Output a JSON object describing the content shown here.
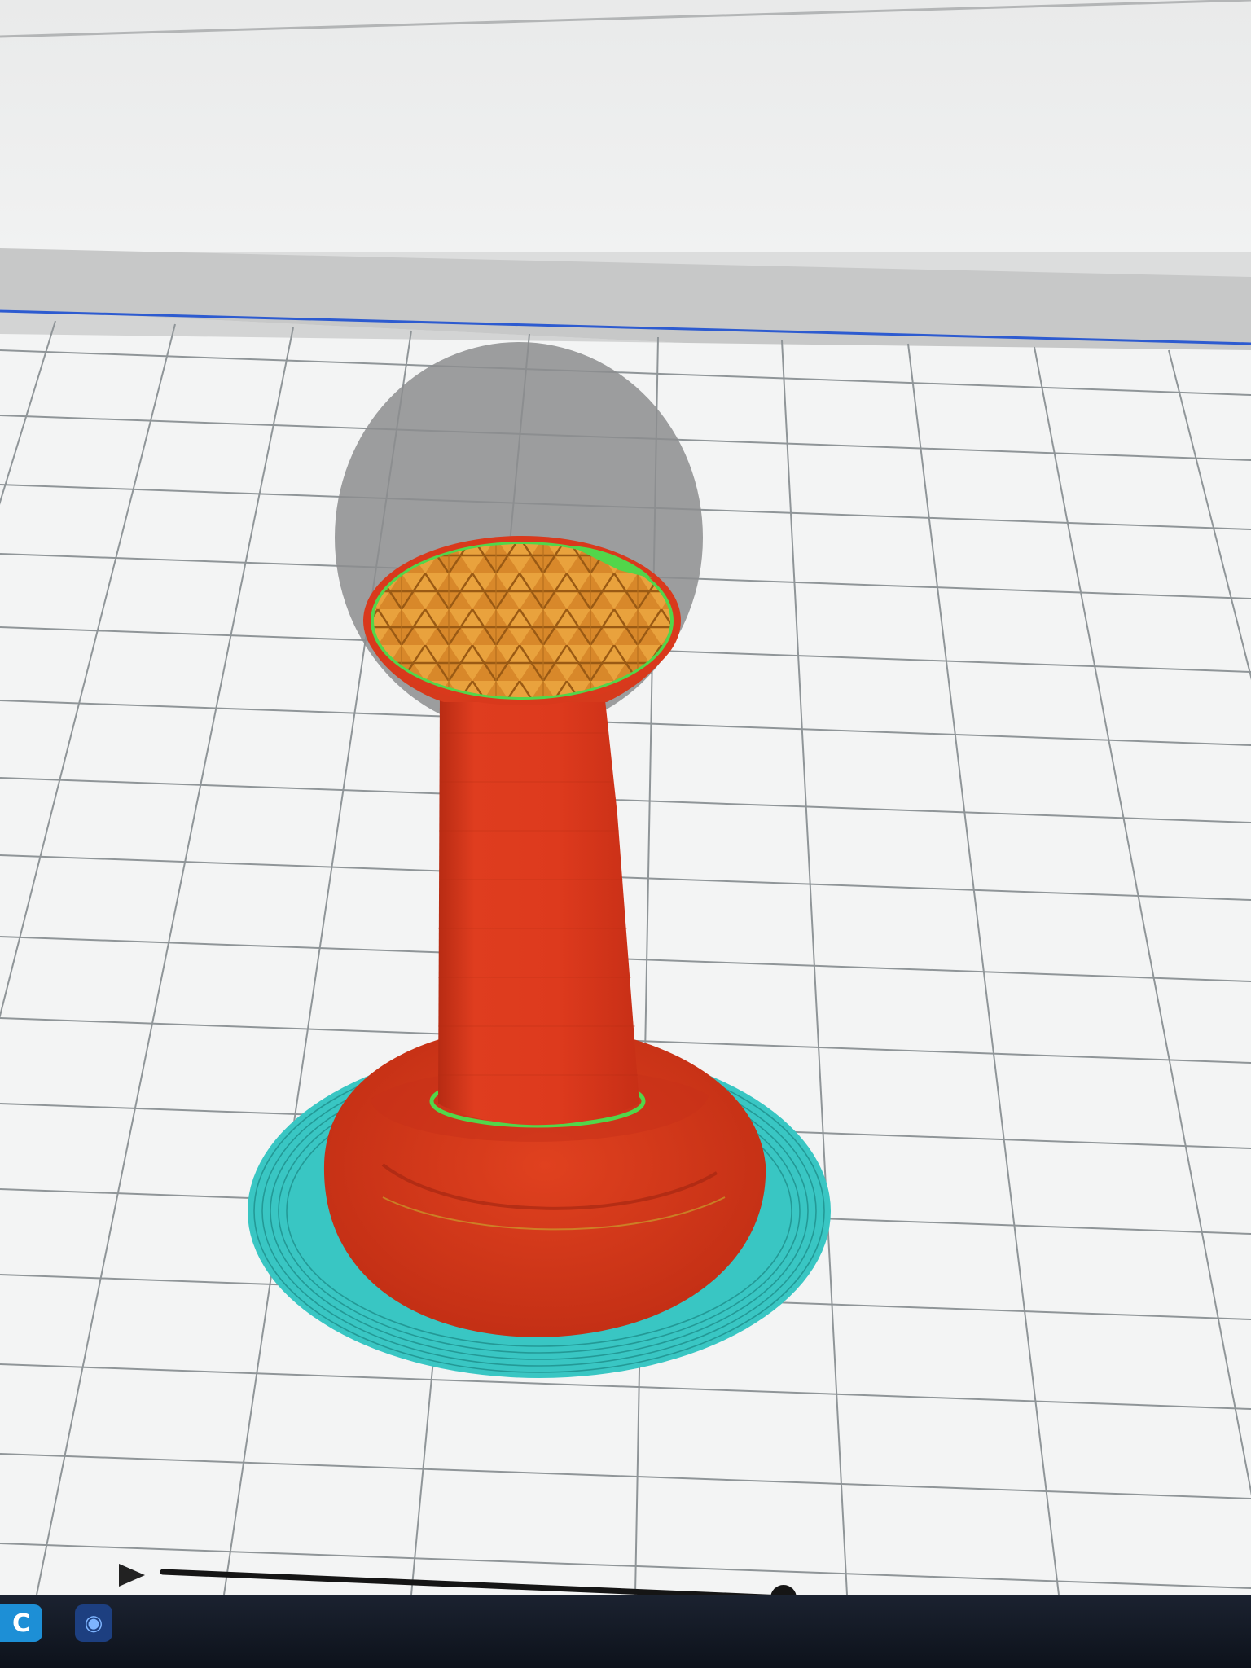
{
  "app": {
    "name": "slicer-layer-preview",
    "accent_color": "#1d8fd6"
  },
  "viewport": {
    "background_color": "#f3f4f4",
    "grid_color": "#8f9598",
    "back_wall_color": "#c7c8c8",
    "horizon_color": "#2d5bd0"
  },
  "model": {
    "wall_color": "#d9391c",
    "infill_color": "#e9a23d",
    "top_skin_color": "#52d64a",
    "skirt_color": "#39c6c3",
    "shadow_color": "#8c8d8e"
  },
  "playback": {
    "play_icon": "play-icon",
    "slider_position": 1.0
  },
  "taskbar": {
    "items": [
      {
        "icon": "app-icon-cura",
        "glyph": "C"
      },
      {
        "icon": "app-icon-globe",
        "glyph": "◉"
      }
    ]
  }
}
